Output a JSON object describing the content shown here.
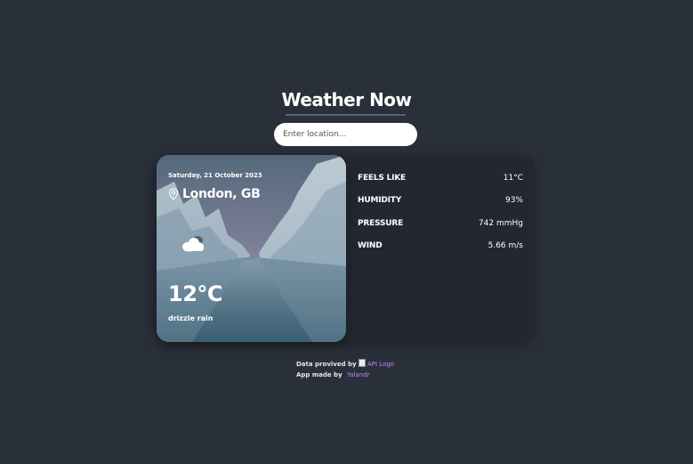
{
  "header": {
    "title": "Weather Now"
  },
  "search": {
    "placeholder": "Enter location..."
  },
  "current": {
    "date": "Saturday, 21 October 2023",
    "location": "London, GB",
    "temperature": "12°C",
    "description": "drizzle rain",
    "icon": "cloud-drizzle-icon"
  },
  "stats": [
    {
      "label": "FEELS LIKE",
      "value": "11°C"
    },
    {
      "label": "HUMIDITY",
      "value": "93%"
    },
    {
      "label": "PRESSURE",
      "value": "742 mmHg"
    },
    {
      "label": "WIND",
      "value": "5.66 m/s"
    }
  ],
  "footer": {
    "provided_by": "Data provived by",
    "api_logo_alt": "API Logo",
    "made_by": "App made by",
    "author": "Yalandr"
  },
  "colors": {
    "background": "#2a303a",
    "panel": "#232830",
    "link": "#c183ff"
  }
}
